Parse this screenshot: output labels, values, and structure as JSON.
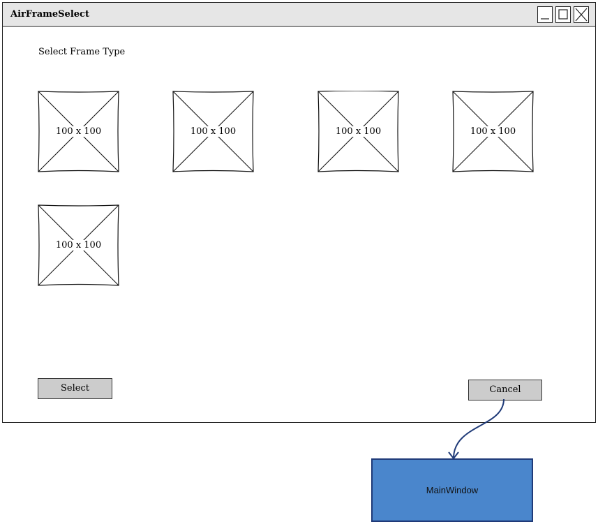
{
  "window": {
    "title": "AirFrameSelect",
    "controls": [
      "minimize",
      "maximize",
      "close"
    ]
  },
  "prompt": "Select Frame Type",
  "thumbnails": [
    {
      "label": "100 x 100"
    },
    {
      "label": "100 x 100"
    },
    {
      "label": "100 x 100"
    },
    {
      "label": "100 x 100"
    },
    {
      "label": "100 x 100"
    }
  ],
  "buttons": {
    "select": "Select",
    "cancel": "Cancel"
  },
  "target": {
    "label": "MainWindow",
    "fill_color": "#4a86cc",
    "border_color": "#1f3a78"
  },
  "connector": {
    "color": "#1f3a78",
    "from": "Cancel",
    "to": "MainWindow"
  }
}
